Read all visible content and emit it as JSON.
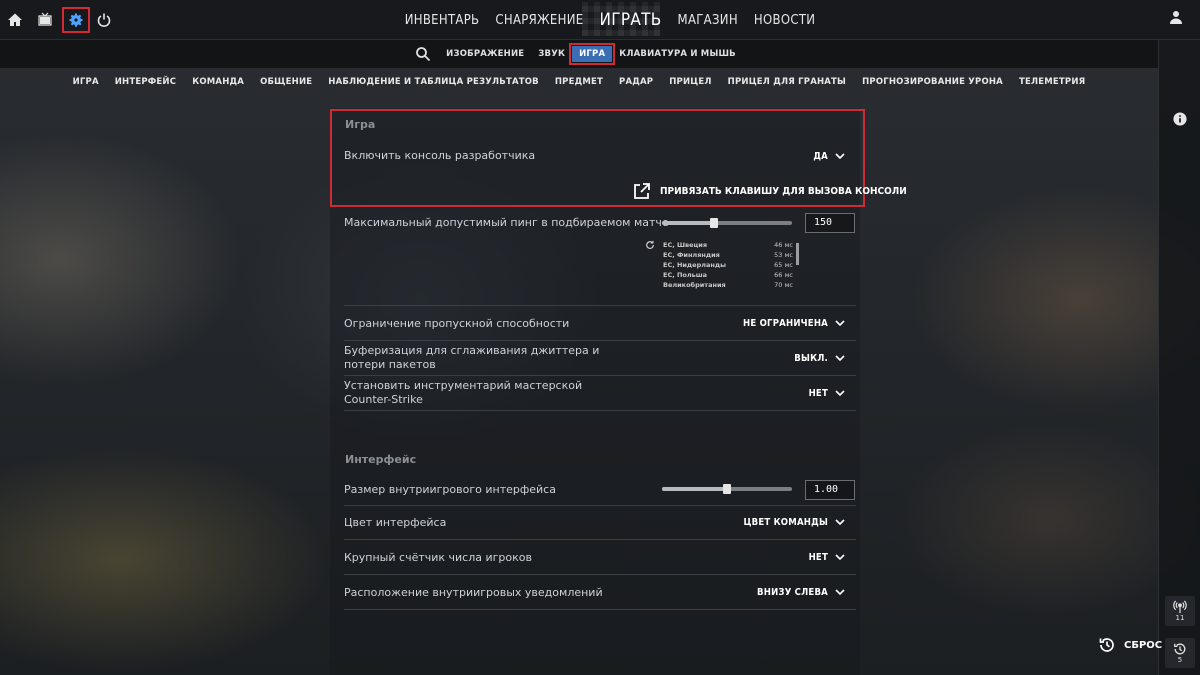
{
  "topbar": {
    "icons": [
      "home-icon",
      "tv-icon",
      "gear-icon",
      "power-icon",
      "profile-icon"
    ],
    "nav": [
      "ИНВЕНТАРЬ",
      "СНАРЯЖЕНИЕ",
      "ИГРАТЬ",
      "МАГАЗИН",
      "НОВОСТИ"
    ]
  },
  "subtabs": {
    "items": [
      "ИЗОБРАЖЕНИЕ",
      "ЗВУК",
      "ИГРА",
      "КЛАВИАТУРА И МЫШЬ"
    ],
    "active": "ИГРА"
  },
  "categories": [
    "ИГРА",
    "ИНТЕРФЕЙС",
    "КОМАНДА",
    "ОБЩЕНИЕ",
    "НАБЛЮДЕНИЕ И ТАБЛИЦА РЕЗУЛЬТАТОВ",
    "ПРЕДМЕТ",
    "РАДАР",
    "ПРИЦЕЛ",
    "ПРИЦЕЛ ДЛЯ ГРАНАТЫ",
    "ПРОГНОЗИРОВАНИЕ УРОНА",
    "ТЕЛЕМЕТРИЯ"
  ],
  "game": {
    "header": "Игра",
    "console_label": "Включить консоль разработчика",
    "console_value": "ДА",
    "bind_label": "ПРИВЯЗАТЬ КЛАВИШУ ДЛЯ ВЫЗОВА КОНСОЛИ",
    "ping_label": "Максимальный допустимый пинг в подбираемом матче",
    "ping_value": "150",
    "ping_slider_fraction": 0.4,
    "servers": [
      {
        "name": "EC, Швеция",
        "ms": "46 мс"
      },
      {
        "name": "EC, Финляндия",
        "ms": "53 мс"
      },
      {
        "name": "EC, Нидерланды",
        "ms": "65 мс"
      },
      {
        "name": "EC, Польша",
        "ms": "66 мс"
      },
      {
        "name": "Великобритания",
        "ms": "70 мс"
      }
    ],
    "bandwidth_label": "Ограничение пропускной способности",
    "bandwidth_value": "НЕ ОГРАНИЧЕНА",
    "buffer_label_1": "Буферизация для сглаживания джиттера и",
    "buffer_label_2": "потери пакетов",
    "buffer_value": "ВЫКЛ.",
    "workshop_label_1": "Установить инструментарий мастерской",
    "workshop_label_2": "Counter-Strike",
    "workshop_value": "НЕТ"
  },
  "interface": {
    "header": "Интерфейс",
    "hud_label": "Размер внутриигрового интерфейса",
    "hud_value": "1.00",
    "hud_slider_fraction": 0.5,
    "color_label": "Цвет интерфейса",
    "color_value": "ЦВЕТ КОМАНДЫ",
    "counter_label": "Крупный счётчик числа игроков",
    "counter_value": "НЕТ",
    "notif_label": "Расположение внутриигровых уведомлений",
    "notif_value": "ВНИЗУ СЛЕВА"
  },
  "rightbar": {
    "signal_count": "11",
    "history_count": "5"
  },
  "reset_label": "СБРОС",
  "colors": {
    "highlight": "#d02a35",
    "active_tab": "#3a6fb5"
  }
}
